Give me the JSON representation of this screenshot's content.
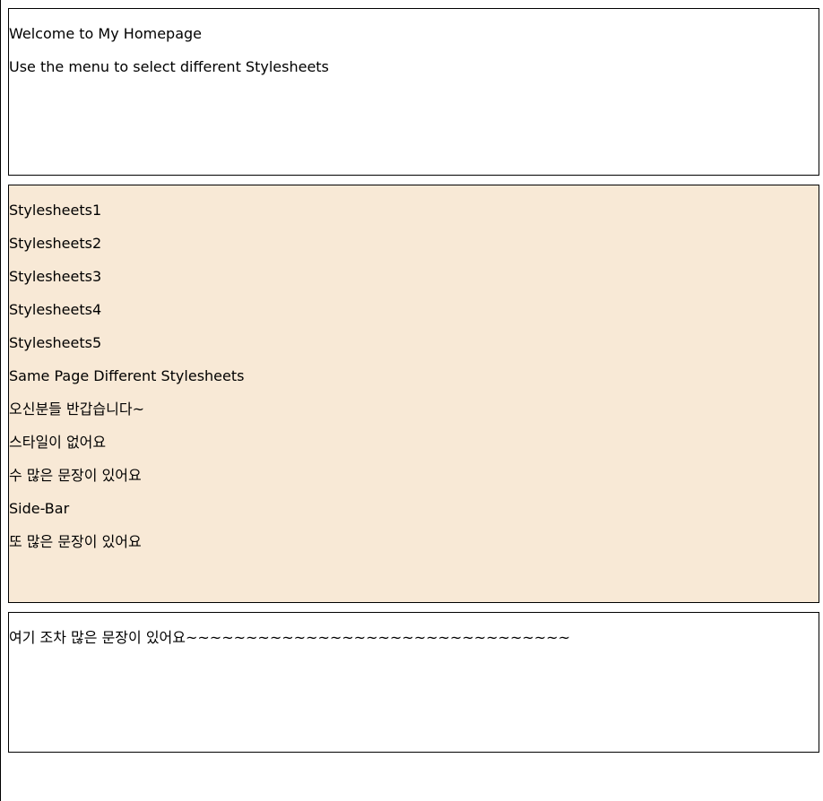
{
  "header": {
    "title": "Welcome to My Homepage",
    "subtitle": "Use the menu to select different Stylesheets"
  },
  "menu": {
    "items": [
      "Stylesheets1",
      "Stylesheets2",
      "Stylesheets3",
      "Stylesheets4",
      "Stylesheets5",
      "Same Page Different Stylesheets",
      "오신분들 반갑습니다~",
      "스타일이 없어요",
      "수 많은 문장이 있어요",
      "Side-Bar",
      "또 많은 문장이 있어요"
    ]
  },
  "footer": {
    "text": "여기 조차 많은 문장이 있어요~~~~~~~~~~~~~~~~~~~~~~~~~~~~~~~~"
  },
  "colors": {
    "menu_background": "#f8e9d6",
    "border": "#000000"
  }
}
